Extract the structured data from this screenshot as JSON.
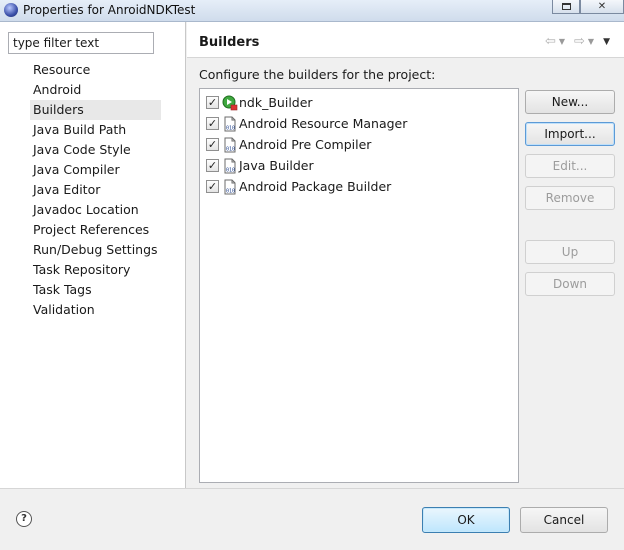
{
  "window": {
    "title": "Properties for AnroidNDKTest"
  },
  "sidebar": {
    "filter_placeholder": "type filter text",
    "items": [
      {
        "label": "Resource"
      },
      {
        "label": "Android"
      },
      {
        "label": "Builders",
        "selected": true
      },
      {
        "label": "Java Build Path"
      },
      {
        "label": "Java Code Style"
      },
      {
        "label": "Java Compiler"
      },
      {
        "label": "Java Editor"
      },
      {
        "label": "Javadoc Location"
      },
      {
        "label": "Project References"
      },
      {
        "label": "Run/Debug Settings"
      },
      {
        "label": "Task Repository"
      },
      {
        "label": "Task Tags"
      },
      {
        "label": "Validation"
      }
    ]
  },
  "main": {
    "title": "Builders",
    "configure_label": "Configure the builders for the project:",
    "builders": [
      {
        "label": "ndk_Builder",
        "checked": true,
        "icon": "external-tool-icon"
      },
      {
        "label": "Android Resource Manager",
        "checked": true,
        "icon": "binary-file-icon"
      },
      {
        "label": "Android Pre Compiler",
        "checked": true,
        "icon": "binary-file-icon"
      },
      {
        "label": "Java Builder",
        "checked": true,
        "icon": "binary-file-icon"
      },
      {
        "label": "Android Package Builder",
        "checked": true,
        "icon": "binary-file-icon"
      }
    ],
    "buttons": {
      "new": "New...",
      "import": "Import...",
      "edit": "Edit...",
      "remove": "Remove",
      "up": "Up",
      "down": "Down"
    }
  },
  "footer": {
    "help_glyph": "?",
    "ok": "OK",
    "cancel": "Cancel"
  },
  "colors": {
    "selection": "#e8e8e8",
    "focus_border": "#3c7fb1"
  }
}
